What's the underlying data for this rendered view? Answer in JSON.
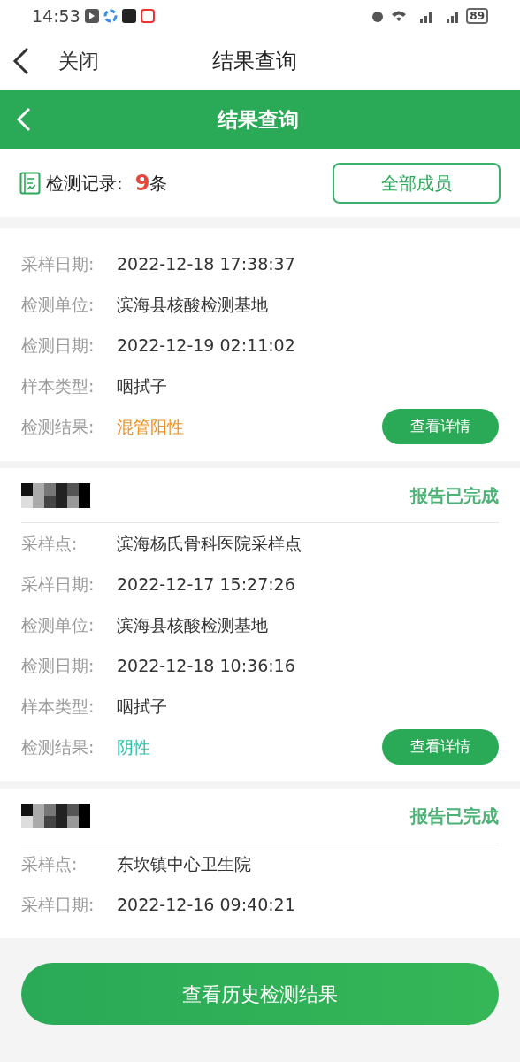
{
  "status_bar": {
    "time": "14:53",
    "battery": "89"
  },
  "nav": {
    "close": "关闭",
    "title": "结果查询"
  },
  "header": {
    "title": "结果查询"
  },
  "records": {
    "label": "检测记录:",
    "count": "9",
    "unit": "条",
    "filter_button": "全部成员"
  },
  "cards": [
    {
      "fields": [
        {
          "label": "采样日期:",
          "value": "2022-12-18 17:38:37"
        },
        {
          "label": "检测单位:",
          "value": "滨海县核酸检测基地"
        },
        {
          "label": "检测日期:",
          "value": "2022-12-19 02:11:02"
        },
        {
          "label": "样本类型:",
          "value": "咽拭子"
        },
        {
          "label": "检测结果:",
          "value": "混管阳性",
          "color": "#f0901e"
        }
      ],
      "detail_button": "查看详情"
    },
    {
      "status": "报告已完成",
      "fields": [
        {
          "label": "采样点:",
          "value": "滨海杨氏骨科医院采样点"
        },
        {
          "label": "采样日期:",
          "value": "2022-12-17 15:27:26"
        },
        {
          "label": "检测单位:",
          "value": "滨海县核酸检测基地"
        },
        {
          "label": "检测日期:",
          "value": "2022-12-18 10:36:16"
        },
        {
          "label": "样本类型:",
          "value": "咽拭子"
        },
        {
          "label": "检测结果:",
          "value": "阴性",
          "color": "#2cc0a4"
        }
      ],
      "detail_button": "查看详情"
    },
    {
      "status": "报告已完成",
      "fields": [
        {
          "label": "采样点:",
          "value": "东坎镇中心卫生院"
        },
        {
          "label": "采样日期:",
          "value": "2022-12-16 09:40:21"
        }
      ]
    }
  ],
  "bottom_button": "查看历史检测结果"
}
